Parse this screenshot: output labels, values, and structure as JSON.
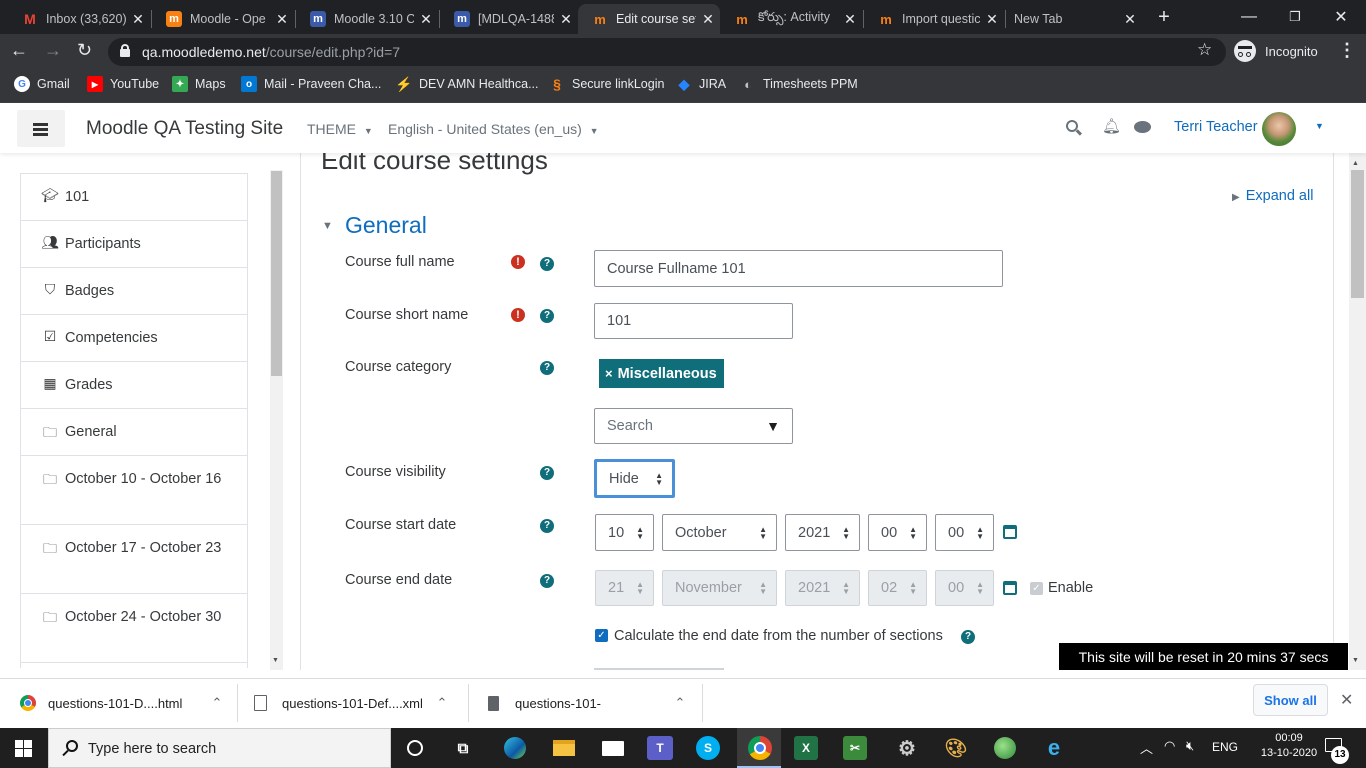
{
  "browser": {
    "tabs": [
      {
        "title": "Inbox (33,620)",
        "icon": "gmail-icon",
        "active": false
      },
      {
        "title": "Moodle - Ope",
        "icon": "moodle-icon",
        "active": false
      },
      {
        "title": "Moodle 3.10 C",
        "icon": "moodle-tracker-icon",
        "active": false
      },
      {
        "title": "[MDLQA-1488",
        "icon": "moodle-tracker-icon",
        "active": false
      },
      {
        "title": "Edit course set",
        "icon": "moodle-icon",
        "active": true
      },
      {
        "title": "కోర్సు: Activity",
        "icon": "moodle-icon",
        "active": false
      },
      {
        "title": "Import questic",
        "icon": "moodle-icon",
        "active": false
      },
      {
        "title": "New Tab",
        "icon": "",
        "active": false
      }
    ],
    "url_host": "qa.moodledemo.net",
    "url_path": "/course/edit.php?id=7",
    "profile": "Incognito",
    "bookmarks": [
      {
        "label": "Gmail",
        "icon": "gmail-icon"
      },
      {
        "label": "YouTube",
        "icon": "youtube-icon"
      },
      {
        "label": "Maps",
        "icon": "maps-icon"
      },
      {
        "label": "Mail - Praveen Cha...",
        "icon": "outlook-icon"
      },
      {
        "label": "DEV AMN Healthca...",
        "icon": "amn-icon"
      },
      {
        "label": "Secure linkLogin",
        "icon": "link-icon"
      },
      {
        "label": "JIRA",
        "icon": "jira-icon"
      },
      {
        "label": "Timesheets PPM",
        "icon": "timesheets-icon"
      }
    ]
  },
  "header": {
    "site_name": "Moodle QA Testing Site",
    "theme_label": "THEME",
    "language": "English - United States (en_us)",
    "user_name": "Terri Teacher"
  },
  "sidebar": {
    "items": [
      {
        "label": "101",
        "icon": "graduation-cap-icon"
      },
      {
        "label": "Participants",
        "icon": "users-icon"
      },
      {
        "label": "Badges",
        "icon": "shield-icon"
      },
      {
        "label": "Competencies",
        "icon": "check-square-icon"
      },
      {
        "label": "Grades",
        "icon": "table-icon"
      },
      {
        "label": "General",
        "icon": "folder-icon"
      },
      {
        "label": "October 10 - October 16",
        "icon": "folder-icon"
      },
      {
        "label": "October 17 - October 23",
        "icon": "folder-icon"
      },
      {
        "label": "October 24 - October 30",
        "icon": "folder-icon"
      }
    ]
  },
  "page": {
    "title": "Edit course settings",
    "expand_all": "Expand all",
    "section_title": "General",
    "fields": {
      "fullname_label": "Course full name",
      "fullname_value": "Course Fullname 101",
      "shortname_label": "Course short name",
      "shortname_value": "101",
      "category_label": "Course category",
      "category_tag": "Miscellaneous",
      "category_search_placeholder": "Search",
      "visibility_label": "Course visibility",
      "visibility_value": "Hide",
      "startdate_label": "Course start date",
      "start_day": "10",
      "start_month": "October",
      "start_year": "2021",
      "start_hour": "00",
      "start_minute": "00",
      "enddate_label": "Course end date",
      "end_day": "21",
      "end_month": "November",
      "end_year": "2021",
      "end_hour": "02",
      "end_minute": "00",
      "enable_label": "Enable",
      "calc_end_label": "Calculate the end date from the number of sections"
    },
    "reset_notice": "This site will be reset in 20 mins 37 secs"
  },
  "downloads": {
    "items": [
      {
        "name": "questions-101-D....html",
        "icon": "chrome-file-icon"
      },
      {
        "name": "questions-101-Def....xml",
        "icon": "xml-file-icon"
      },
      {
        "name": "questions-101-",
        "icon": "file-icon"
      }
    ],
    "show_all": "Show all"
  },
  "taskbar": {
    "search_placeholder": "Type here to search",
    "language": "ENG",
    "time": "00:09",
    "date": "13-10-2020",
    "notification_count": "13"
  },
  "colors": {
    "accent": "#0f6e7a",
    "link": "#0f6cbf",
    "error": "#ca3120",
    "chrome_dark": "#202124"
  }
}
